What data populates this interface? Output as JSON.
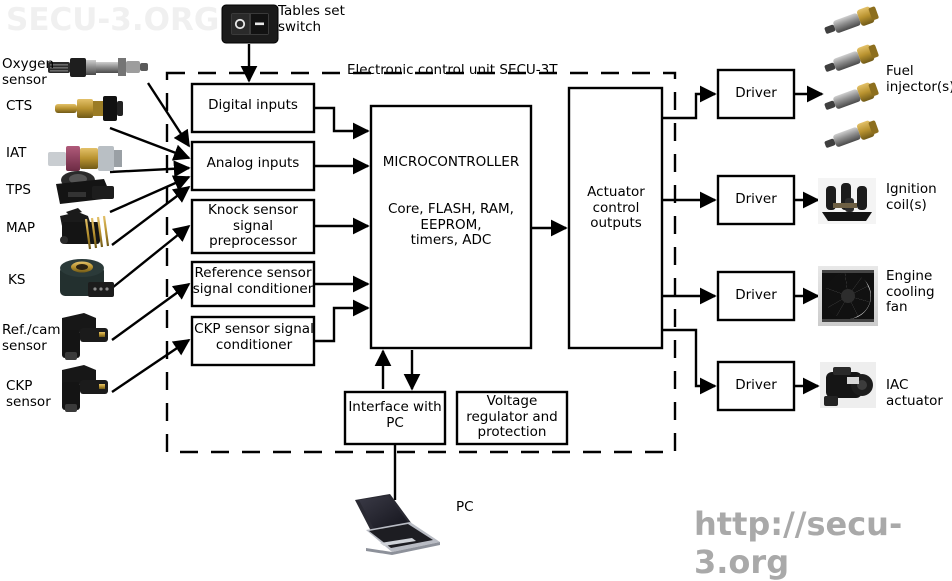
{
  "watermarks": {
    "top_left": "SECU-3.ORG",
    "bottom_right": "http://secu-3.org"
  },
  "diagram": {
    "boundary_label": "Electronic control unit SECU-3T",
    "switch": {
      "label": "Tables set\nswitch",
      "icon": "rocker-switch-icon"
    },
    "pc": {
      "label": "PC",
      "icon": "laptop-icon"
    }
  },
  "sensors": [
    {
      "label": "Oxygen\nsensor",
      "icon": "oxygen-sensor-icon"
    },
    {
      "label": "CTS",
      "icon": "coolant-temp-sensor-icon"
    },
    {
      "label": "IAT",
      "icon": "intake-air-temp-sensor-icon"
    },
    {
      "label": "TPS",
      "icon": "throttle-position-sensor-icon"
    },
    {
      "label": "MAP",
      "icon": "map-sensor-icon"
    },
    {
      "label": "KS",
      "icon": "knock-sensor-icon"
    },
    {
      "label": "Ref./cam\nsensor",
      "icon": "cam-sensor-icon"
    },
    {
      "label": "CKP\nsensor",
      "icon": "crank-sensor-icon"
    }
  ],
  "input_blocks": [
    {
      "label": "Digital inputs"
    },
    {
      "label": "Analog inputs"
    },
    {
      "label": "Knock sensor\nsignal\npreprocessor"
    },
    {
      "label": "Reference sensor\nsignal conditioner"
    },
    {
      "label": "CKP sensor signal\nconditioner"
    }
  ],
  "microcontroller": {
    "title": "MICROCONTROLLER",
    "details": "Core, FLASH, RAM,\nEEPROM,\ntimers, ADC"
  },
  "actuator_block": {
    "label": "Actuator\ncontrol\noutputs"
  },
  "support_blocks": [
    {
      "label": "Interface with\nPC"
    },
    {
      "label": "Voltage\nregulator and\nprotection"
    }
  ],
  "drivers": [
    {
      "label": "Driver"
    },
    {
      "label": "Driver"
    },
    {
      "label": "Driver"
    },
    {
      "label": "Driver"
    }
  ],
  "actuators": [
    {
      "label": "Fuel\ninjector(s)",
      "icon": "fuel-injector-icon"
    },
    {
      "label": "Ignition\ncoil(s)",
      "icon": "ignition-coil-icon"
    },
    {
      "label": "Engine\ncooling\nfan",
      "icon": "cooling-fan-icon"
    },
    {
      "label": "IAC\nactuator",
      "icon": "iac-actuator-icon"
    }
  ],
  "colors": {
    "line": "#000000",
    "watermark_top": "#f0f0f0",
    "watermark_bottom": "#a9a9a9",
    "background": "#ffffff"
  }
}
